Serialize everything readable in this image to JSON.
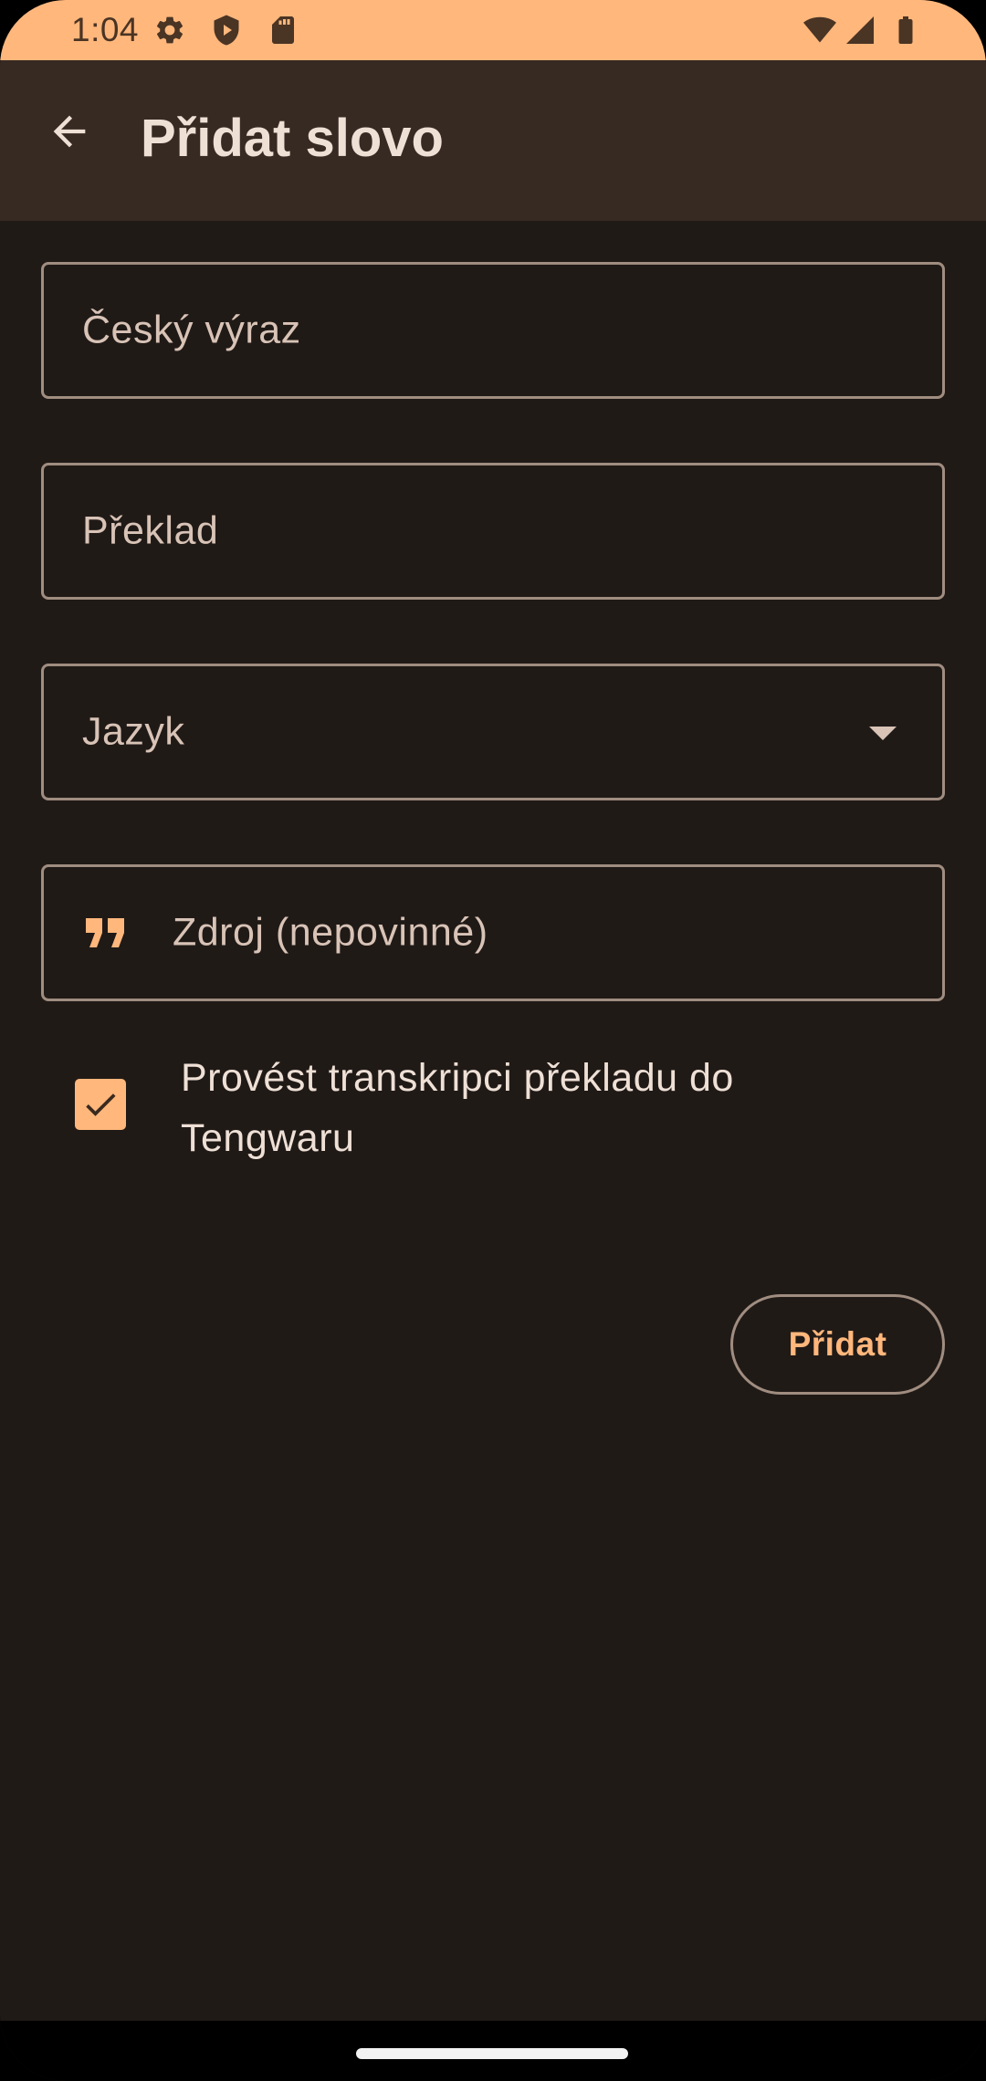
{
  "status_bar": {
    "time": "1:04",
    "background": "#ffb77c",
    "icons": [
      "settings-icon",
      "shield-play-icon",
      "sd-card-icon",
      "wifi-icon",
      "signal-icon",
      "battery-icon"
    ]
  },
  "app_bar": {
    "back_icon": "arrow-back-icon",
    "title": "Přidat slovo"
  },
  "form": {
    "czech_field": {
      "placeholder": "Český výraz",
      "value": ""
    },
    "translation_field": {
      "placeholder": "Překlad",
      "value": ""
    },
    "language_select": {
      "placeholder": "Jazyk",
      "selected": ""
    },
    "source_field": {
      "placeholder": "Zdroj (nepovinné)",
      "value": "",
      "icon": "format-quote-icon"
    },
    "transcribe_checkbox": {
      "label": "Provést transkripci překladu do Tengwaru",
      "checked": true
    },
    "submit_label": "Přidat"
  },
  "colors": {
    "accent": "#ffb77c",
    "background": "#201a17",
    "app_bar": "#372a22",
    "outline": "#a08d80",
    "on_surface": "#efe0d6",
    "on_surface_variant": "#d8c3b6"
  }
}
